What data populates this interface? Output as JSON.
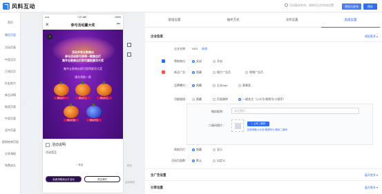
{
  "header": {
    "logo_text": "风料互动",
    "notice": "活动暂未发布，请前往后台完成设置",
    "save_label": "预览与发布",
    "publish_label": "保存"
  },
  "sidebar": {
    "items": [
      {
        "label": "首页",
        "active": false
      },
      {
        "label": "微信页面",
        "active": true
      },
      {
        "label": "活动页面",
        "active": false
      },
      {
        "label": "中奖页页",
        "active": false
      },
      {
        "label": "已领页页",
        "active": false
      },
      {
        "label": "好友助力",
        "active": false
      },
      {
        "label": "新品详情",
        "active": false
      },
      {
        "label": "抽奖页面",
        "active": false
      },
      {
        "label": "中奖页面",
        "active": false
      },
      {
        "label": "没中页面",
        "active": false
      },
      {
        "label": "提前结束页面",
        "active": false
      },
      {
        "label": "分享海报",
        "active": false
      },
      {
        "label": "免费送礼",
        "active": false
      }
    ]
  },
  "phone": {
    "status_left": "•••••",
    "status_time": "7:27 AM",
    "status_right": "100%",
    "title": "参与活动赢大奖",
    "poster_lines": [
      "活动共有五款南瓜",
      "参与活动即可获得一款南瓜灯",
      "集齐五款南瓜灯即可赢取豪华大奖",
      "集齐五款南瓜即可获得豪华大奖",
      "请先领取一款"
    ],
    "pumpkin_labels": [
      "南瓜灯一",
      "南瓜灯二",
      "南瓜灯三",
      "南瓜灯四",
      "南瓜灯五"
    ],
    "sheet_title": "活动说明",
    "sheet_desc": "活动奖品",
    "sheet_extra": "一等奖",
    "btn_left": "免费领取南瓜灯活动",
    "btn_right": "关注我们"
  },
  "stage": {
    "hint_preview": "预览",
    "hint_bottom": "活动规则"
  },
  "tabs": [
    {
      "label": "基础设置",
      "active": false
    },
    {
      "label": "抽奖方式",
      "active": false
    },
    {
      "label": "派奖设置",
      "active": false
    },
    {
      "label": "高级设置",
      "active": true
    }
  ],
  "sections": {
    "enterprise": "企业信息",
    "enterprise_link": "收起更多 ▴",
    "ad": "全广告设置",
    "ad_link": "展开更多 ▾",
    "share": "分享设置",
    "share_link": "展开更多 ▾"
  },
  "form": {
    "company_label": "企业名称：",
    "company_value": "XXX",
    "company_link": "修改",
    "switch_label": "赞助商位：",
    "switch_opts": [
      "关闭",
      "开启"
    ],
    "ad_label": "新品广告：",
    "ad_opts": [
      "隐藏",
      "图片广告页",
      "视频广告页"
    ],
    "brand_label": "品牌曝光：",
    "brand_opts": [
      "隐藏",
      "企业logo",
      "赛事类"
    ],
    "function_label": "功能链接：",
    "function_opts": [
      "隐藏",
      "页面跳转",
      "一键关注（公众号/视频号/小程序）"
    ],
    "nickname_label": "微信昵称：",
    "nickname_placeholder": "关注我们",
    "qrcode_label": "二维码图片：",
    "upload_label": "+ 上传二维码",
    "upload_link": "如何获取公众号/视频号/小程序二维码",
    "cover_label": "帮助页片：",
    "cover_opts": [
      "隐藏",
      "显示"
    ],
    "page_label": "活动页面数：",
    "page_opts": [
      "默认",
      "自定义"
    ]
  }
}
